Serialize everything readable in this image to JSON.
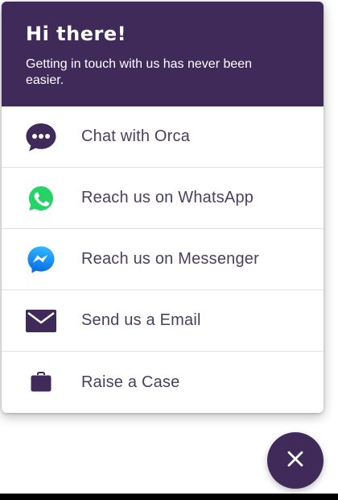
{
  "header": {
    "title": "Hi there!",
    "subtitle": "Getting in touch with us has never been easier."
  },
  "options": [
    {
      "label": "Chat with Orca",
      "icon": "chat-bubble-icon"
    },
    {
      "label": "Reach us on WhatsApp",
      "icon": "whatsapp-icon"
    },
    {
      "label": "Reach us on Messenger",
      "icon": "messenger-icon"
    },
    {
      "label": "Send us a Email",
      "icon": "envelope-icon"
    },
    {
      "label": "Raise a Case",
      "icon": "briefcase-icon"
    }
  ],
  "fab": {
    "icon": "close-icon"
  },
  "colors": {
    "brand": "#3f2a5a",
    "label_text": "#4a3f5e",
    "whatsapp": "#25d366",
    "messenger": "#0a84ff"
  }
}
